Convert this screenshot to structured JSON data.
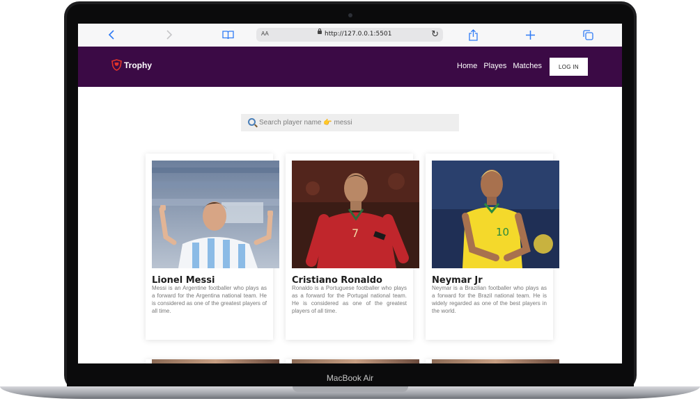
{
  "device": {
    "model_label": "MacBook Air"
  },
  "browser": {
    "address_text_size": "AA",
    "url": "http://127.0.0.1:5501",
    "icons": [
      "back-icon",
      "forward-icon",
      "reader-icon",
      "lock-icon",
      "reload-icon",
      "share-icon",
      "new-tab-icon",
      "tabs-icon"
    ]
  },
  "site": {
    "brand": "Trophy",
    "nav": [
      "Home",
      "Playes",
      "Matches"
    ],
    "login_label": "LOG IN",
    "colors": {
      "nav_bg": "#3b0a45",
      "logo_red": "#e0332a"
    }
  },
  "search": {
    "placeholder": "Search player name 👉 messi"
  },
  "players": [
    {
      "name": "Lionel Messi",
      "desc": "Messi is an Argentine footballer who plays as a forward for the Argentina national team. He is considered as one of the greatest players of all time."
    },
    {
      "name": "Cristiano Ronaldo",
      "desc": "Ronaldo is a Portuguese footballer who plays as a forward for the Portugal national team. He is considered as one of the greatest players of all time."
    },
    {
      "name": "Neymar Jr",
      "desc": "Neymar is a Brazilian footballer who plays as a forward for the Brazil national team. He is widely regarded as one of the best players in the world."
    }
  ]
}
